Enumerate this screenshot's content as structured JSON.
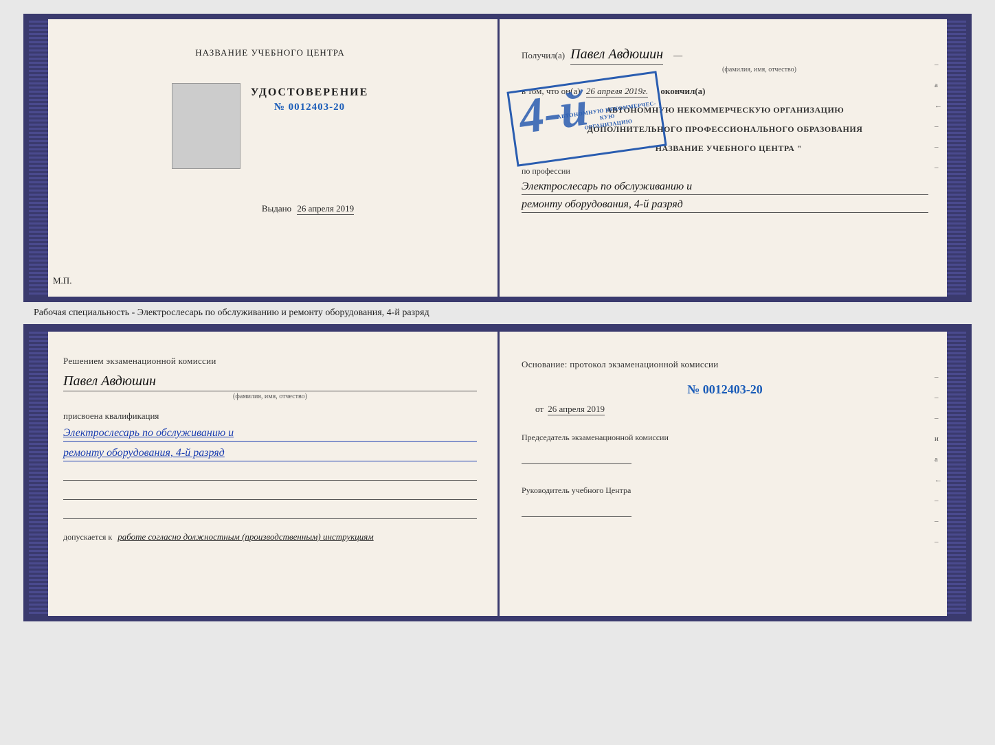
{
  "top_left": {
    "center_title": "НАЗВАНИЕ УЧЕБНОГО ЦЕНТРА",
    "cert_label": "УДОСТОВЕРЕНИЕ",
    "cert_number": "№ 0012403-20",
    "issued_label": "Выдано",
    "issued_date": "26 апреля 2019",
    "mp_label": "М.П."
  },
  "top_right": {
    "received_prefix": "Получил(а)",
    "recipient_name": "Павел Авдюшин",
    "recipient_hint": "(фамилия, имя, отчество)",
    "in_that_text": "в том, что он(а)",
    "in_that_date": "26 апреля 2019г.",
    "finished_text": "окончил(а)",
    "org_line1": "АВТОНОМНУЮ НЕКОММЕРЧЕСКУЮ ОРГАНИЗАЦИЮ",
    "org_line2": "ДОПОЛНИТЕЛЬНОГО ПРОФЕССИОНАЛЬНОГО ОБРАЗОВАНИЯ",
    "org_name": "\" НАЗВАНИЕ УЧЕБНОГО ЦЕНТРА \"",
    "profession_prefix": "по профессии",
    "profession_line1": "Электрослесарь по обслуживанию и",
    "profession_line2": "ремонту оборудования, 4-й разряд",
    "stamp_number": "4-й",
    "stamp_text": "РА\nАВТОНОМНУЮ НЕКОММЕРЧЕСКУЮ"
  },
  "middle": {
    "text": "Рабочая специальность - Электрослесарь по обслуживанию и ремонту оборудования, 4-й разряд"
  },
  "bottom_left": {
    "resolution_title": "Решением экзаменационной  комиссии",
    "person_name": "Павел Авдюшин",
    "person_hint": "(фамилия, имя, отчество)",
    "qualification_label": "присвоена квалификация",
    "qualification_line1": "Электрослесарь по обслуживанию и",
    "qualification_line2": "ремонту оборудования, 4-й разряд",
    "допускается_prefix": "допускается к",
    "допускается_value": "работе согласно должностным (производственным) инструкциям"
  },
  "bottom_right": {
    "osnov_text": "Основание: протокол экзаменационной  комиссии",
    "protocol_number": "№  0012403-20",
    "protocol_date_prefix": "от",
    "protocol_date": "26 апреля 2019",
    "chairman_title": "Председатель экзаменационной комиссии",
    "director_title": "Руководитель учебного Центра"
  },
  "side_marks": [
    "–",
    "а",
    "←",
    "–",
    "–",
    "–"
  ]
}
